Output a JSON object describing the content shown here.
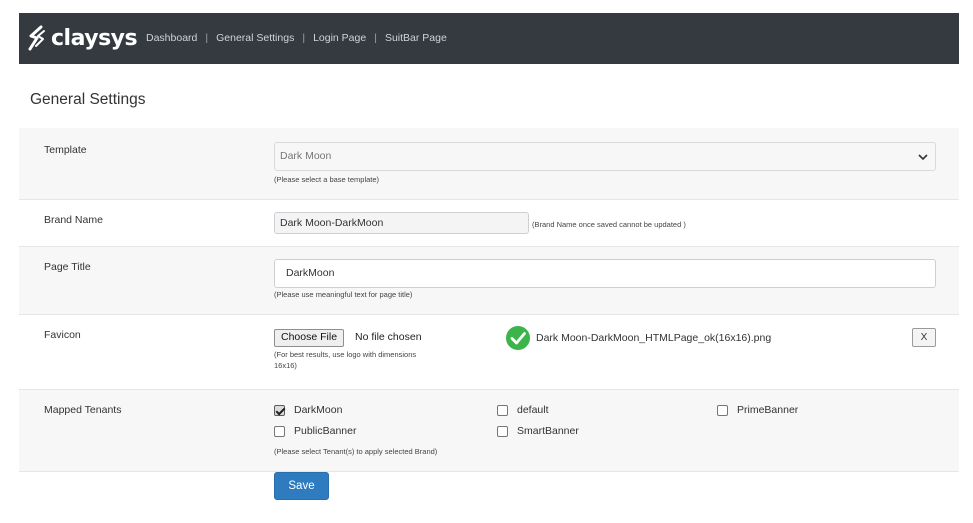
{
  "brand": {
    "logo_text": "claysys",
    "icon": "claysys-logo-icon"
  },
  "nav": [
    {
      "label": "Dashboard"
    },
    {
      "label": "General Settings"
    },
    {
      "label": "Login Page"
    },
    {
      "label": "SuitBar Page"
    }
  ],
  "nav_separator": "|",
  "page": {
    "title": "General Settings"
  },
  "template": {
    "label": "Template",
    "value": "Dark Moon",
    "hint": "(Please select a base template)"
  },
  "brand_name": {
    "label": "Brand Name",
    "value": "Dark Moon-DarkMoon",
    "hint": "(Brand Name once saved cannot be updated )"
  },
  "page_title_field": {
    "label": "Page Title",
    "value": "DarkMoon",
    "hint": "(Please use meaningful text for page title)"
  },
  "favicon": {
    "label": "Favicon",
    "choose_label": "Choose File",
    "no_file": "No file chosen",
    "hint_line1": "(For best results, use logo with dimensions",
    "hint_line2": "16x16)",
    "file_name": "Dark Moon-DarkMoon_HTMLPage_ok(16x16).png",
    "remove_label": "X",
    "status_color": "#3bb54a"
  },
  "tenants": {
    "label": "Mapped Tenants",
    "items": [
      {
        "name": "DarkMoon",
        "checked": true
      },
      {
        "name": "default",
        "checked": false
      },
      {
        "name": "PrimeBanner",
        "checked": false
      },
      {
        "name": "PublicBanner",
        "checked": false
      },
      {
        "name": "SmartBanner",
        "checked": false
      }
    ],
    "hint": "(Please select Tenant(s) to apply selected Brand)"
  },
  "actions": {
    "save_label": "Save",
    "save_color": "#2e7bbf"
  },
  "colors": {
    "topbar": "#343a40",
    "row_alt": "#f7f7f7"
  }
}
